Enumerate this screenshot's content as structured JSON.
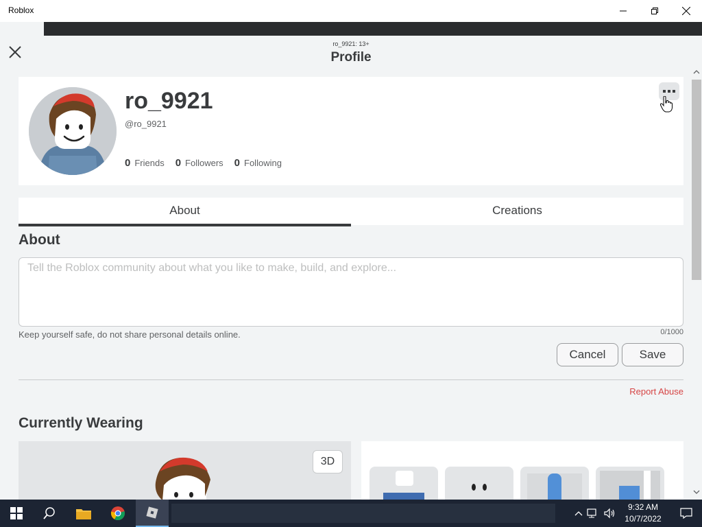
{
  "window": {
    "title": "Roblox"
  },
  "modal": {
    "subtitle": "ro_9921: 13+",
    "title": "Profile"
  },
  "profile": {
    "display_name": "ro_9921",
    "handle": "@ro_9921",
    "stats": [
      {
        "count": "0",
        "label": "Friends"
      },
      {
        "count": "0",
        "label": "Followers"
      },
      {
        "count": "0",
        "label": "Following"
      }
    ]
  },
  "tabs": [
    {
      "label": "About",
      "active": true
    },
    {
      "label": "Creations",
      "active": false
    }
  ],
  "about": {
    "heading": "About",
    "value": "",
    "placeholder": "Tell the Roblox community about what you like to make, build, and explore...",
    "safety_note": "Keep yourself safe, do not share personal details online.",
    "char_count": "0/1000",
    "cancel_label": "Cancel",
    "save_label": "Save",
    "report_label": "Report Abuse"
  },
  "wearing": {
    "heading": "Currently Wearing",
    "toggle_3d_label": "3D",
    "items": [
      "shirt",
      "face",
      "pants",
      "pants"
    ]
  },
  "taskbar": {
    "time": "9:32 AM",
    "date": "10/7/2022",
    "apps": [
      "file-explorer",
      "chrome",
      "roblox"
    ]
  },
  "colors": {
    "accent": "#393b3d",
    "report": "#d64545",
    "background": "#f2f4f5"
  }
}
